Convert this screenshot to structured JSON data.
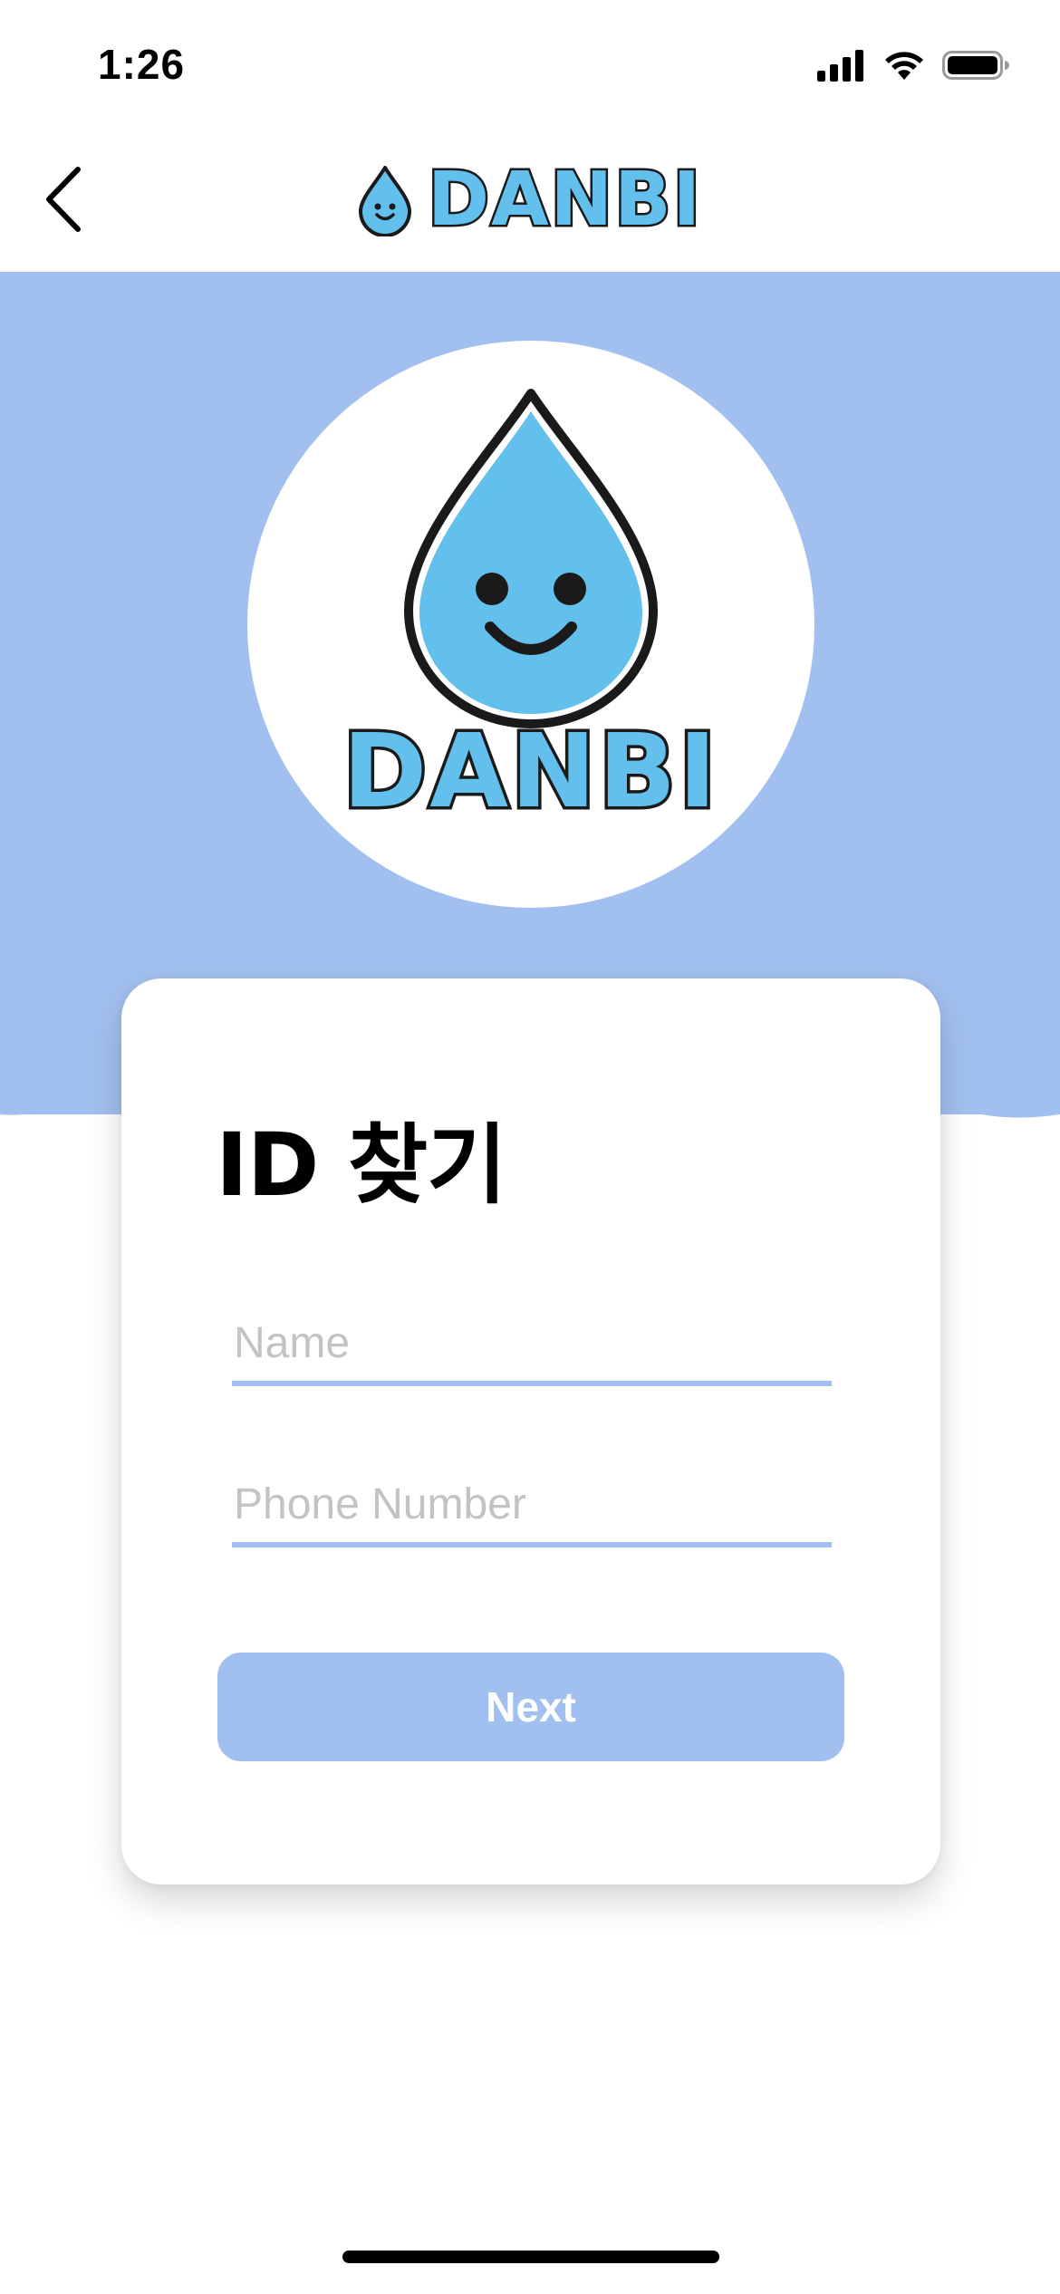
{
  "status_bar": {
    "time": "1:26",
    "icons": [
      "cellular-signal-icon",
      "wifi-icon",
      "battery-icon"
    ]
  },
  "header": {
    "back_icon": "chevron-left-icon",
    "logo_icon": "water-drop-face-icon",
    "logo_text": "DANBI"
  },
  "hero": {
    "logo_icon": "water-drop-face-icon",
    "logo_text": "DANBI"
  },
  "form": {
    "title": "ID 찾기",
    "name_field": {
      "placeholder": "Name",
      "value": ""
    },
    "phone_field": {
      "placeholder": "Phone Number",
      "value": ""
    },
    "next_label": "Next"
  },
  "colors": {
    "accent": "#a2c0ef",
    "logo_blue": "#63bfec",
    "placeholder": "#c3c3c3"
  }
}
